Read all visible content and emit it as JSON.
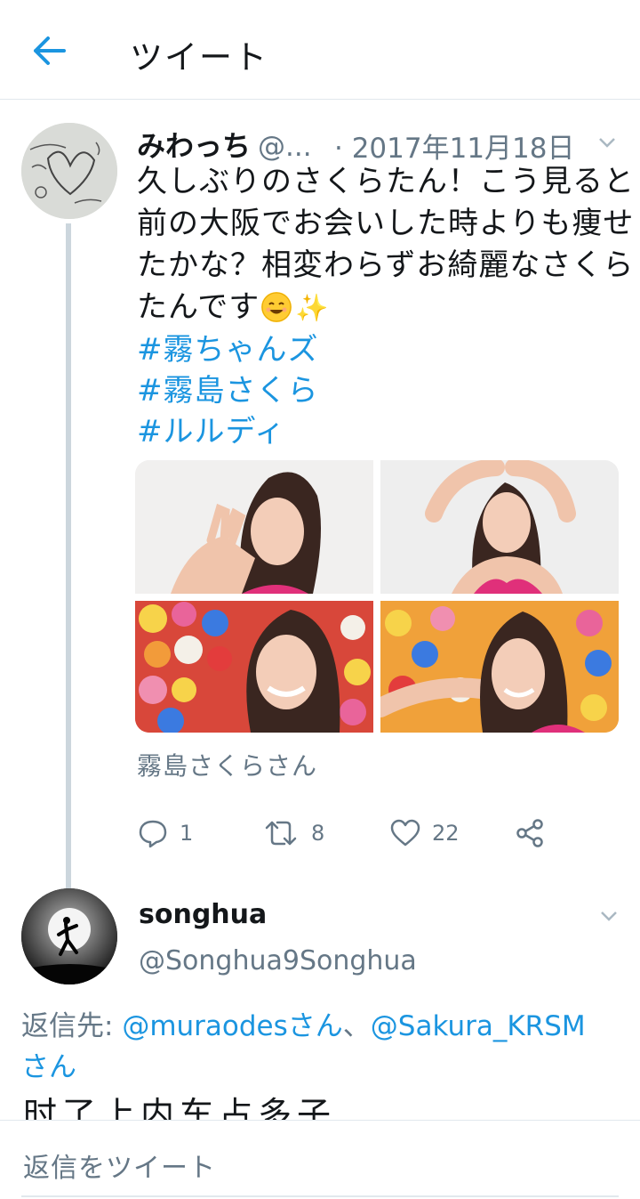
{
  "header": {
    "title": "ツイート"
  },
  "tweet": {
    "name": "みわっち",
    "handle": "@...",
    "date": "· 2017年11月18日",
    "lines": [
      "久しぶりのさくらたん！こう見ると",
      "前の大阪でお会いした時よりも痩せ",
      "たかな？相変わらずお綺麗なさくら",
      "たんです"
    ],
    "hashtags": [
      "#霧ちゃんズ",
      "#霧島さくら",
      "#ルルディ"
    ],
    "tagged_people": "霧島さくらさん",
    "actions": {
      "reply_count": "1",
      "retweet_count": "8",
      "like_count": "22"
    }
  },
  "reply": {
    "name": "songhua",
    "handle": "@Songhua9Songhua",
    "reply_to_label": "返信先: ",
    "mention_1": "@muraodesさん",
    "separator": "、",
    "mention_2": "@Sakura_KRSM",
    "mention_2_suffix": "さん",
    "text_partial": "时了上内车占多子"
  },
  "composer": {
    "placeholder": "返信をツイート"
  },
  "colors": {
    "accent": "#1b95e0",
    "secondary_text": "#657786",
    "divider": "#e1e8ed"
  }
}
